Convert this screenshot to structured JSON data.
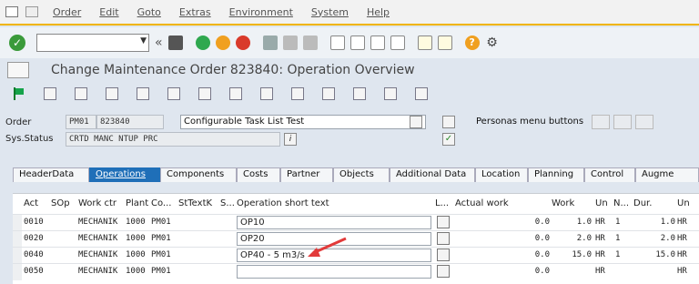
{
  "menu": [
    "Order",
    "Edit",
    "Goto",
    "Extras",
    "Environment",
    "System",
    "Help"
  ],
  "toolbar": {
    "command_value": ""
  },
  "title": "Change Maintenance Order 823840: Operation Overview",
  "header": {
    "order_label": "Order",
    "order_type": "PM01",
    "order_number": "823840",
    "order_text": "Configurable Task List Test",
    "status_label": "Sys.Status",
    "status_value": "CRTD MANC NTUP PRC",
    "status_info": "i",
    "personas": "Personas menu buttons"
  },
  "tabs": [
    "HeaderData",
    "Operations",
    "Components",
    "Costs",
    "Partner",
    "Objects",
    "Additional Data",
    "Location",
    "Planning",
    "Control",
    "Augme"
  ],
  "active_tab": "Operations",
  "columns": [
    "Act",
    "SOp",
    "Work ctr",
    "Plant",
    "Co...",
    "StTextK",
    "S...",
    "Operation short text",
    "L...",
    "Actual work",
    "Work",
    "Un",
    "N...",
    "Dur.",
    "Un"
  ],
  "rows": [
    {
      "act": "0010",
      "sop": "",
      "wc": "MECHANIK",
      "plant": "1000",
      "co": "PM01",
      "sttext": "",
      "s": "",
      "text": "OP10",
      "actual": "0.0",
      "work": "1.0",
      "un": "HR",
      "n": "1",
      "dur": "1.0",
      "un2": "HR"
    },
    {
      "act": "0020",
      "sop": "",
      "wc": "MECHANIK",
      "plant": "1000",
      "co": "PM01",
      "sttext": "",
      "s": "",
      "text": "OP20",
      "actual": "0.0",
      "work": "2.0",
      "un": "HR",
      "n": "1",
      "dur": "2.0",
      "un2": "HR"
    },
    {
      "act": "0040",
      "sop": "",
      "wc": "MECHANIK",
      "plant": "1000",
      "co": "PM01",
      "sttext": "",
      "s": "",
      "text": "OP40 - 5 m3/s",
      "actual": "0.0",
      "work": "15.0",
      "un": "HR",
      "n": "1",
      "dur": "15.0",
      "un2": "HR"
    },
    {
      "act": "0050",
      "sop": "",
      "wc": "MECHANIK",
      "plant": "1000",
      "co": "PM01",
      "sttext": "",
      "s": "",
      "text": "",
      "actual": "0.0",
      "work": "",
      "un": "HR",
      "n": "",
      "dur": "",
      "un2": "HR"
    }
  ],
  "colors": {
    "accent": "#1f6fb8",
    "ok": "#3a9a3a",
    "annotation": "#e23a3a"
  }
}
